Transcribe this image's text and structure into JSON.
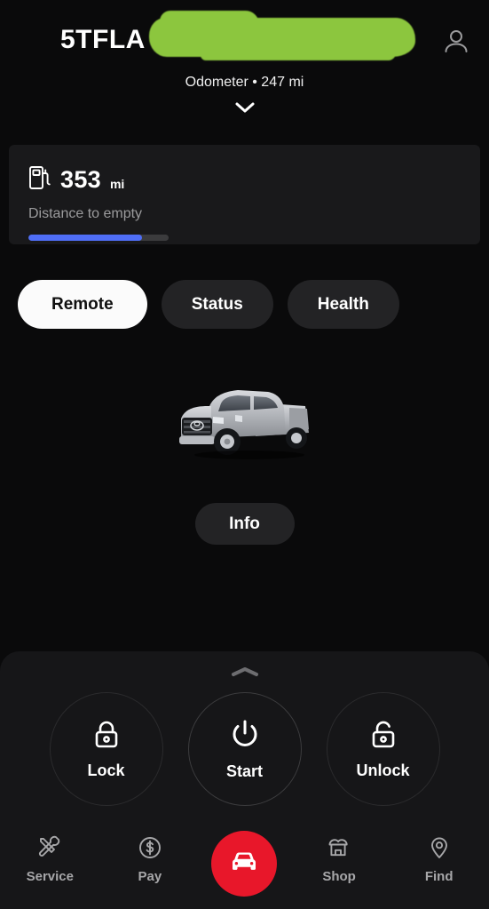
{
  "header": {
    "vin_visible": "5TFLA",
    "redaction_color": "#8cc63e",
    "odometer": "Odometer • 247 mi",
    "account_icon": "person-icon",
    "expand_icon": "chevron-down-icon"
  },
  "fuel_card": {
    "icon": "fuel-pump-icon",
    "value": "353",
    "unit": "mi",
    "label": "Distance to empty",
    "progress_percent": 81,
    "fill_color": "#4f6ef7",
    "track_color": "#3b3b3d"
  },
  "tabs": [
    {
      "label": "Remote",
      "active": true
    },
    {
      "label": "Status",
      "active": false
    },
    {
      "label": "Health",
      "active": false
    }
  ],
  "vehicle": {
    "icon": "pickup-truck-image",
    "description": "Silver Toyota Tundra pickup truck"
  },
  "info_button": {
    "label": "Info"
  },
  "sheet": {
    "handle_icon": "chevron-up-icon",
    "actions": [
      {
        "label": "Lock",
        "icon": "lock-closed-icon"
      },
      {
        "label": "Start",
        "icon": "power-icon"
      },
      {
        "label": "Unlock",
        "icon": "lock-open-icon"
      }
    ]
  },
  "bottom_nav": {
    "items": [
      {
        "label": "Service",
        "icon": "tools-icon"
      },
      {
        "label": "Pay",
        "icon": "dollar-circle-icon"
      },
      {
        "label": "Shop",
        "icon": "storefront-icon"
      },
      {
        "label": "Find",
        "icon": "map-pin-icon"
      }
    ],
    "fab": {
      "icon": "car-front-icon",
      "color": "#e8172a"
    }
  }
}
